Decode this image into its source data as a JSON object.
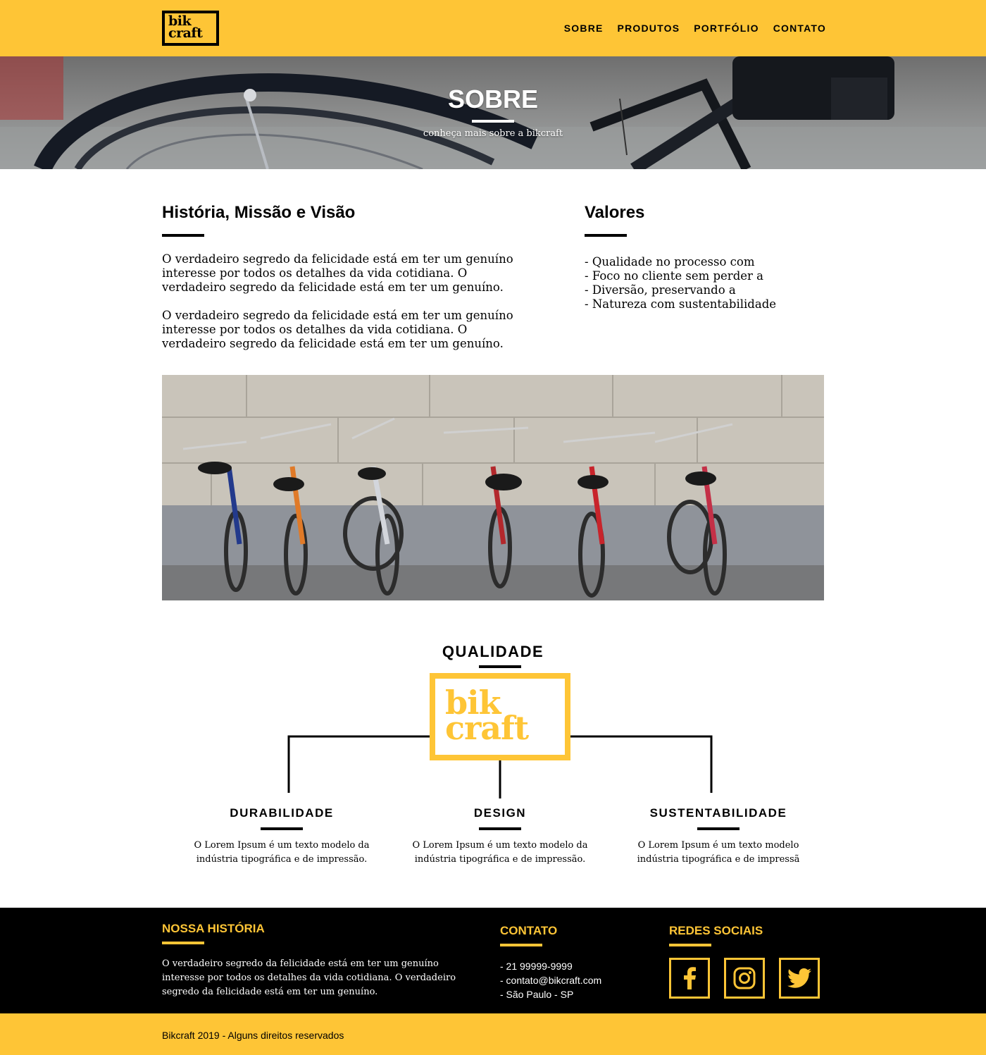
{
  "header": {
    "logo_line1": "bik",
    "logo_line2": "craft",
    "nav": [
      "SOBRE",
      "PRODUTOS",
      "PORTFÓLIO",
      "CONTATO"
    ]
  },
  "hero": {
    "title": "SOBRE",
    "subtitle": "conheça mais sobre a bikcraft"
  },
  "about": {
    "left_title": "História, Missão e Visão",
    "paragraphs": [
      "O verdadeiro segredo da felicidade está em ter um genuíno interesse por todos os detalhes da vida cotidiana. O verdadeiro segredo da felicidade está em ter um genuíno.",
      "O verdadeiro segredo da felicidade está em ter um genuíno interesse por todos os detalhes da vida cotidiana. O verdadeiro segredo da felicidade está em ter um genuíno."
    ],
    "right_title": "Valores",
    "values": [
      "- Qualidade no processo com",
      "- Foco no cliente sem perder a",
      "- Diversão, preservando a",
      "- Natureza com sustentabilidade"
    ]
  },
  "quality": {
    "title": "QUALIDADE",
    "logo_line1": "bik",
    "logo_line2": "craft",
    "features": [
      {
        "title": "DURABILIDADE",
        "text_line1": "O Lorem Ipsum é um texto modelo da",
        "text_line2": "indústria tipográfica e de impressão."
      },
      {
        "title": "DESIGN",
        "text_line1": "O Lorem Ipsum é um texto modelo da",
        "text_line2": "indústria tipográfica e de impressão."
      },
      {
        "title": "SUSTENTABILIDADE",
        "text_line1": "O Lorem Ipsum é um texto modelo",
        "text_line2": "indústria tipográfica e de impressã"
      }
    ]
  },
  "footer": {
    "history_title": "NOSSA HISTÓRIA",
    "history_text": "O verdadeiro segredo da felicidade está em ter um genuíno interesse por todos os detalhes da vida cotidiana. O verdadeiro segredo da felicidade está em ter um genuíno.",
    "contact_title": "CONTATO",
    "contacts": [
      "- 21 99999-9999",
      "- contato@bikcraft.com",
      "- São Paulo - SP"
    ],
    "social_title": "REDES SOCIAIS",
    "socials": [
      "facebook-icon",
      "instagram-icon",
      "twitter-icon"
    ],
    "copyright": "Bikcraft 2019 - Alguns direitos reservados"
  },
  "colors": {
    "brand_yellow": "#FEC536",
    "dark": "#000000"
  }
}
